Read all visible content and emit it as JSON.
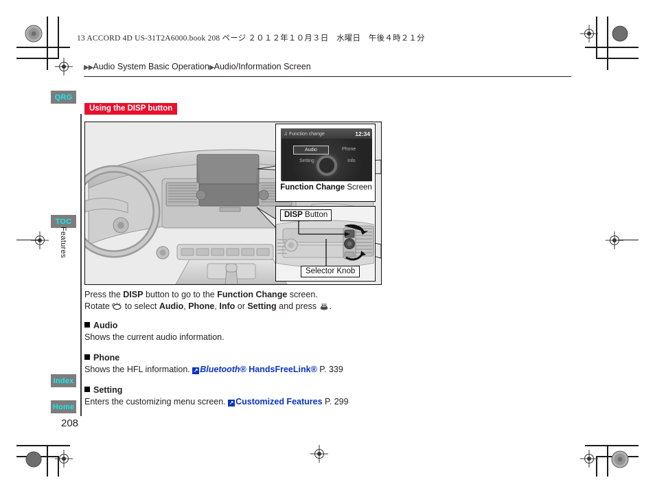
{
  "print_header": {
    "text": "13 ACCORD 4D US-31T2A6000.book   208 ページ   ２０１２年１０月３日　水曜日　午後４時２１分"
  },
  "breadcrumb": {
    "arrow_double": "▶▶",
    "arrow_single": "▶",
    "level1": "Audio System Basic Operation",
    "level2": "Audio/Information Screen"
  },
  "side_tabs": [
    {
      "label": "QRG",
      "name": "qrg"
    },
    {
      "label": "TOC",
      "name": "toc"
    },
    {
      "label": "Index",
      "name": "index"
    },
    {
      "label": "Home",
      "name": "home"
    }
  ],
  "vertical_label": "Features",
  "banner": {
    "label": "Using the DISP button",
    "color": "#e8112d"
  },
  "illustration": {
    "screen_callout": {
      "status_title": "Function change",
      "clock": "12:34",
      "menu_items": [
        "Audio",
        "Phone",
        "Setting",
        "Info"
      ],
      "selected_item": "Audio",
      "caption_bold": "Function Change",
      "caption_rest": " Screen"
    },
    "panel_callout": {
      "label_bold": "DISP",
      "label_rest": " Button",
      "knob_label": "Selector Knob"
    }
  },
  "body": {
    "line1_pre": "Press the ",
    "line1_disp": "DISP",
    "line1_mid": " button to go to the ",
    "line1_fc": "Function Change",
    "line1_end": " screen.",
    "line2_pre": "Rotate ",
    "line2_mid": " to select ",
    "line2_audio": "Audio",
    "line2_comma1": ", ",
    "line2_phone": "Phone",
    "line2_comma2": ", ",
    "line2_info": "Info",
    "line2_or": " or ",
    "line2_setting": "Setting",
    "line2_end": " and press ",
    "line2_period": "."
  },
  "sections": [
    {
      "heading": "Audio",
      "text": "Shows the current audio information.",
      "link": null,
      "link_page": null
    },
    {
      "heading": "Phone",
      "text": "Shows the HFL information. ",
      "link_italic": "Bluetooth",
      "link_sup1": "®",
      "link_rest": " HandsFreeLink",
      "link_sup2": "®",
      "link_page": "P. 339"
    },
    {
      "heading": "Setting",
      "text": "Enters the customizing menu screen. ",
      "link": "Customized Features",
      "link_page": "P. 299"
    }
  ],
  "page_number": "208",
  "colors": {
    "banner_red": "#e8112d",
    "tab_gray": "#7d7d7d",
    "tab_cyan": "#19e6ef",
    "link_blue": "#0b33c1",
    "illus_bg": "#ebebeb"
  }
}
